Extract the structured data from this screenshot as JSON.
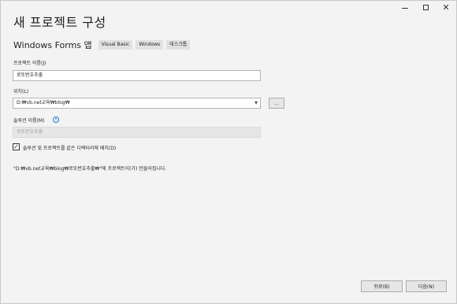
{
  "window": {
    "title": "새 프로젝트 구성",
    "controls": {
      "minimize": "—",
      "maximize": "□",
      "close": "✕"
    }
  },
  "template": {
    "name": "Windows Forms 앱",
    "tags": [
      "Visual Basic",
      "Windows",
      "데스크톱"
    ]
  },
  "project_name": {
    "label": "프로젝트 이름(J)",
    "value": "로또번호추출"
  },
  "location": {
    "label": "위치(L)",
    "value": "D:₩vb.net교육₩blog₩",
    "browse_label": "..."
  },
  "solution_name": {
    "label": "솔루션 이름(M)",
    "placeholder": "로또번호추출",
    "info_icon": "i"
  },
  "same_directory": {
    "checked": true,
    "check_glyph": "✓",
    "label": "솔루션 및 프로젝트를 같은 디렉터리에 배치(D)"
  },
  "path_note": "\"D:₩vb.net교육₩blog₩로또번호추출₩\"에 프로젝트이(가) 만들어집니다.",
  "footer": {
    "back_label": "뒤로(B)",
    "next_label": "다음(N)"
  }
}
